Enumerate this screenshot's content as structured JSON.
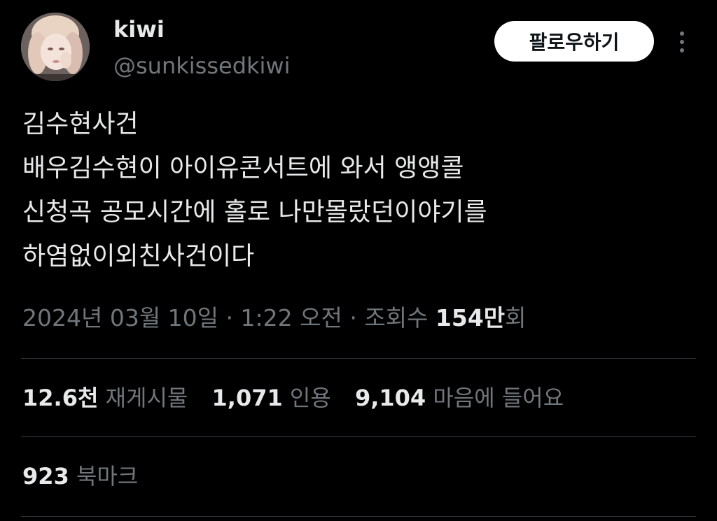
{
  "user": {
    "display_name": "kiwi",
    "handle": "@sunkissedkiwi",
    "avatar_icon": "profile-photo"
  },
  "header": {
    "follow_label": "팔로우하기",
    "more_icon": "more-options-icon"
  },
  "tweet": {
    "lines": [
      "김수현사건",
      "배우김수현이 아이유콘서트에 와서 앵앵콜",
      "신청곡 공모시간에 홀로 나만몰랐던이야기를",
      "하염없이외친사건이다"
    ]
  },
  "meta": {
    "date": "2024년 03월 10일",
    "separator1": " · ",
    "time": "1:22 오전",
    "separator2": " · ",
    "views_prefix": "조회수 ",
    "views_count": "154만",
    "views_suffix": "회"
  },
  "stats": {
    "reposts_count": "12.6천",
    "reposts_label": "재게시물",
    "quotes_count": "1,071",
    "quotes_label": "인용",
    "likes_count": "9,104",
    "likes_label": "마음에 들어요",
    "bookmarks_count": "923",
    "bookmarks_label": "북마크"
  },
  "colors": {
    "background": "#000000",
    "primary_text": "#e7e9ea",
    "secondary_text": "#71767b",
    "divider": "#2f3336",
    "button_bg": "#ffffff",
    "button_text": "#0f1419"
  }
}
